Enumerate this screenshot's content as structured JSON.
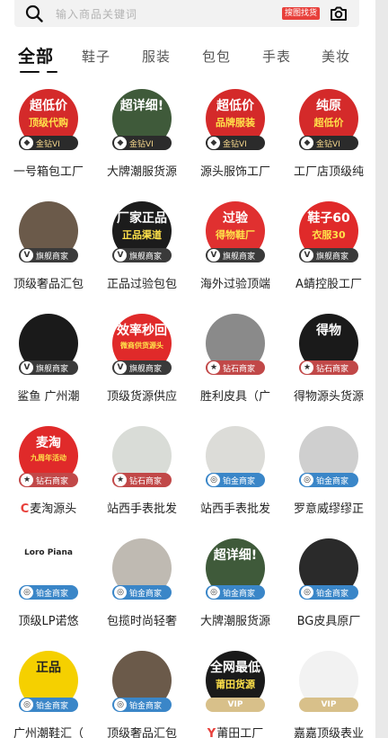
{
  "search": {
    "placeholder": "输入商品关键词",
    "image_search_label": "搜图找货"
  },
  "tabs": [
    {
      "label": "全部",
      "active": true
    },
    {
      "label": "鞋子"
    },
    {
      "label": "服装"
    },
    {
      "label": "包包"
    },
    {
      "label": "手表"
    },
    {
      "label": "美妆"
    }
  ],
  "colors": {
    "accent": "#e8403b",
    "gold_badge": "#2b2b2b",
    "diamond_badge": "#c14848",
    "platinum_badge": "#3a86c8",
    "vip_badge": "#d8c08a"
  },
  "shops": [
    {
      "name": "一号箱包工厂",
      "badge": "金钻VI",
      "tier": "gold",
      "art": [
        "超低价",
        "顶级代购"
      ],
      "bg": "#d42a2a"
    },
    {
      "name": "大牌潮服货源",
      "badge": "金钻VI",
      "tier": "gold",
      "art": [
        "超详细!",
        ""
      ],
      "bg": "#3f5a3a"
    },
    {
      "name": "源头服饰工厂",
      "badge": "金钻VI",
      "tier": "gold",
      "art": [
        "超低价",
        "品牌服装"
      ],
      "bg": "#d42a2a"
    },
    {
      "name": "工厂店顶级纯",
      "badge": "金钻VI",
      "tier": "gold",
      "art": [
        "纯原",
        "超低价"
      ],
      "bg": "#d42a2a"
    },
    {
      "name": "顶级奢品汇包",
      "badge": "旗舰商家",
      "tier": "flag",
      "art": [
        "",
        ""
      ],
      "bg": "#6b5a4a"
    },
    {
      "name": "正品过验包包",
      "badge": "旗舰商家",
      "tier": "flag",
      "art": [
        "厂家正品",
        "正品渠道"
      ],
      "bg": "#1c1c1c"
    },
    {
      "name": "海外过验顶端",
      "badge": "旗舰商家",
      "tier": "flag",
      "art": [
        "过验",
        "得物鞋厂"
      ],
      "bg": "#e03030"
    },
    {
      "name": "A蜻控股工厂",
      "badge": "旗舰商家",
      "tier": "flag",
      "art": [
        "鞋子60",
        "衣服30"
      ],
      "bg": "#e02a2a"
    },
    {
      "name": "鲨鱼 广州潮",
      "badge": "旗舰商家",
      "tier": "flag",
      "art": [
        "",
        ""
      ],
      "bg": "#1a1a1a"
    },
    {
      "name": "顶级货源供应",
      "badge": "旗舰商家",
      "tier": "flag",
      "art": [
        "效率秒回",
        "微商供货源头"
      ],
      "bg": "#e02a2a"
    },
    {
      "name": "胜利皮具（广",
      "badge": "钻石商家",
      "tier": "diamond",
      "art": [
        "",
        ""
      ],
      "bg": "#8a8a8a"
    },
    {
      "name": "得物源头货源",
      "badge": "钻石商家",
      "tier": "diamond",
      "art": [
        "得物",
        ""
      ],
      "bg": "#1a1a1a"
    },
    {
      "name": "麦淘源头",
      "prefix": "C",
      "badge": "钻石商家",
      "tier": "diamond",
      "art": [
        "麦淘",
        "九周年活动"
      ],
      "bg": "#e02a2a"
    },
    {
      "name": "站西手表批发",
      "badge": "钻石商家",
      "tier": "diamond",
      "art": [
        "",
        ""
      ],
      "bg": "#d9dcd7"
    },
    {
      "name": "站西手表批发",
      "badge": "铂金商家",
      "tier": "plat",
      "art": [
        "",
        ""
      ],
      "bg": "#dcdcd8"
    },
    {
      "name": "罗意威缪缪正",
      "badge": "铂金商家",
      "tier": "plat",
      "art": [
        "",
        ""
      ],
      "bg": "#cfcfcf"
    },
    {
      "name": "顶级LP诺悠",
      "badge": "铂金商家",
      "tier": "plat",
      "art": [
        "Loro Piana",
        ""
      ],
      "bg": "#ffffff"
    },
    {
      "name": "包揽时尚轻奢",
      "badge": "铂金商家",
      "tier": "plat",
      "art": [
        "",
        ""
      ],
      "bg": "#bfbab2"
    },
    {
      "name": "大牌潮服货源",
      "badge": "铂金商家",
      "tier": "plat",
      "art": [
        "超详细!",
        ""
      ],
      "bg": "#3f5a3a"
    },
    {
      "name": "BG皮具原厂",
      "badge": "铂金商家",
      "tier": "plat",
      "art": [
        "",
        ""
      ],
      "bg": "#2a2a2a"
    },
    {
      "name": "广州潮鞋汇（",
      "badge": "铂金商家",
      "tier": "plat",
      "art": [
        "正品",
        ""
      ],
      "bg": "#f5d000"
    },
    {
      "name": "顶级奢品汇包",
      "badge": "铂金商家",
      "tier": "plat",
      "art": [
        "",
        ""
      ],
      "bg": "#6b5a4a"
    },
    {
      "name": "莆田工厂",
      "prefix": "Y",
      "badge": "VIP",
      "tier": "vip",
      "art": [
        "全网最低",
        "莆田货源"
      ],
      "bg": "#1a1a1a"
    },
    {
      "name": "嘉嘉顶级表业",
      "badge": "VIP",
      "tier": "vip",
      "art": [
        "",
        ""
      ],
      "bg": "#f2f2f2"
    }
  ]
}
